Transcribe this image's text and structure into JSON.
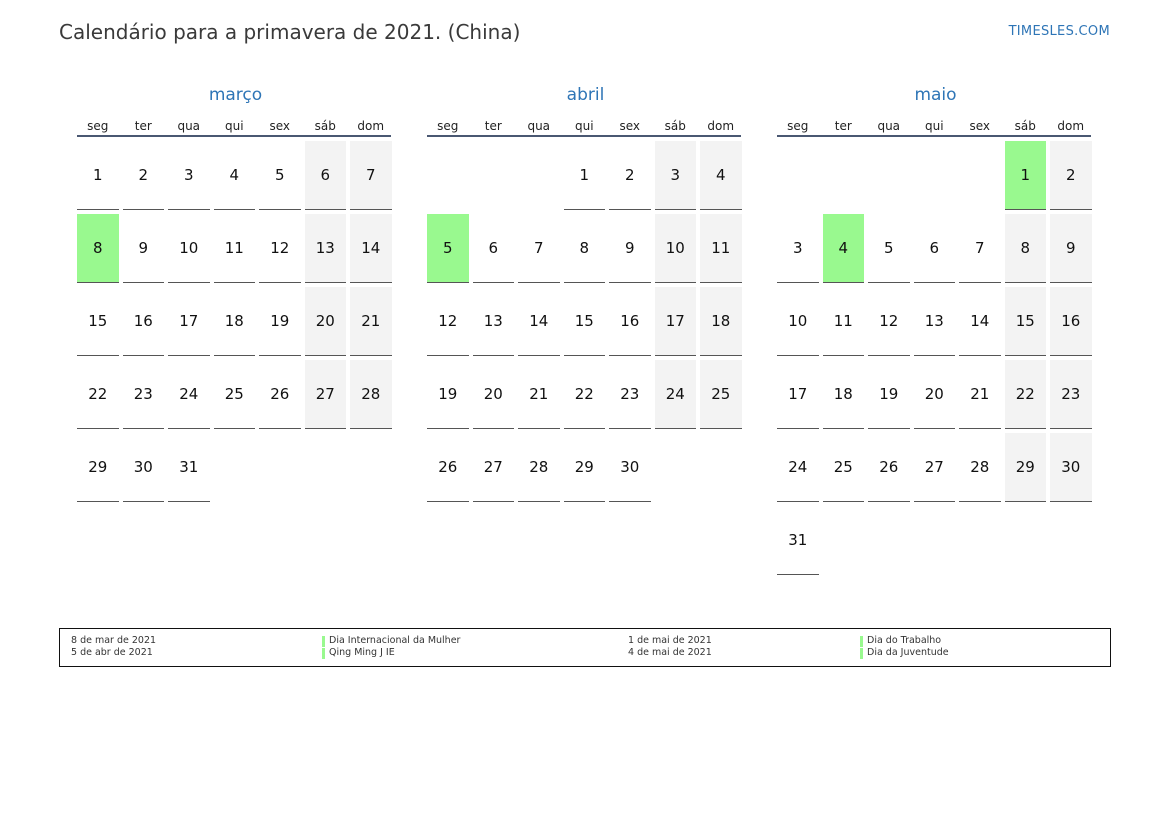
{
  "header": {
    "title": "Calendário para a primavera de 2021. (China)",
    "site": "TIMESLES.COM"
  },
  "weekdays": [
    "seg",
    "ter",
    "qua",
    "qui",
    "sex",
    "sáb",
    "dom"
  ],
  "colors": {
    "month_title": "#2e75b6",
    "holiday": "#99f98f",
    "weekend": "#f3f3f3"
  },
  "months": [
    {
      "name": "março",
      "offset": 0,
      "days": 31,
      "holidays": [
        8
      ]
    },
    {
      "name": "abril",
      "offset": 3,
      "days": 30,
      "holidays": [
        5
      ]
    },
    {
      "name": "maio",
      "offset": 5,
      "days": 31,
      "holidays": [
        1,
        4
      ]
    }
  ],
  "legend": {
    "left": {
      "dates": [
        "8 de mar de 2021",
        "5 de abr de 2021"
      ],
      "names": [
        "Dia Internacional da Mulher",
        "Qing Ming J IE"
      ]
    },
    "right": {
      "dates": [
        "1 de mai de 2021",
        "4 de mai de 2021"
      ],
      "names": [
        "Dia do Trabalho",
        "Dia da Juventude"
      ]
    }
  }
}
